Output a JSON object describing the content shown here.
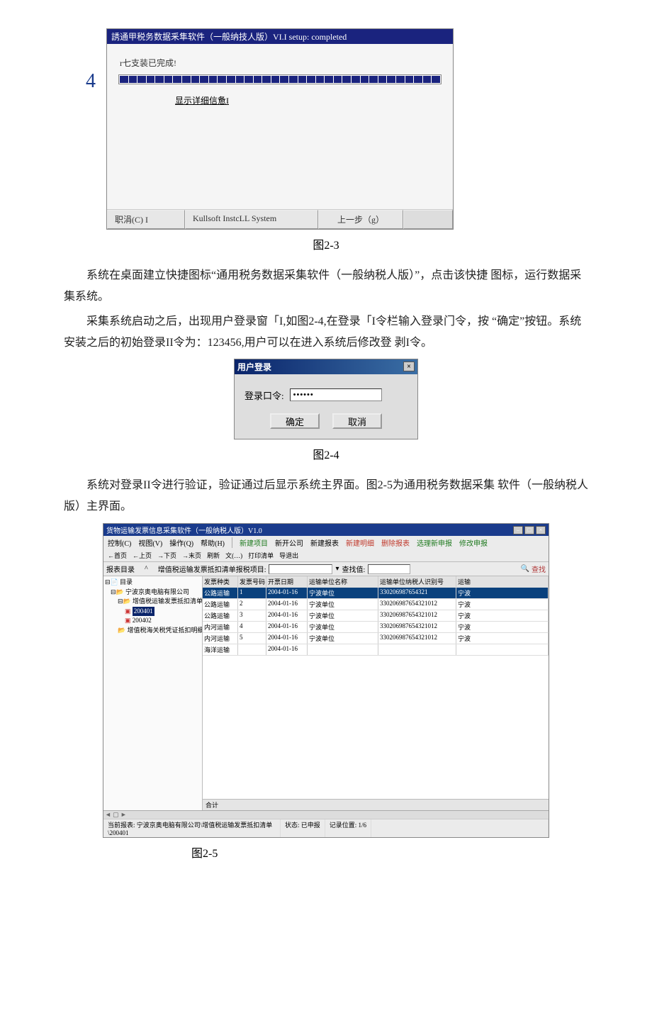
{
  "installer": {
    "title": "誘通甲税务数据釆隼软件（一般纳技人版）VI.I setup: completed",
    "done_text": "r七支装已完成!",
    "details_link": "显示详细信惫I",
    "footer": {
      "cancel": "职涓(C) I",
      "brand": "Kullsoft InstcLL System",
      "back": "上一步（g）"
    },
    "progress_label": "4"
  },
  "caption_2_3": "图2-3",
  "para1": "系统在桌面建立快捷图标“通用税务数据采集软件（一般纳税人版）”，点击该快捷 图标，运行数据采集系统。",
  "para2": "采集系统启动之后，出现用户登录窗「I,如图2-4,在登录「I令栏输入登录门令，按 “确定”按钮。系统安装之后的初始登录II令为：123456,用户可以在进入系统后修改登 剥I令。",
  "login": {
    "title": "用户登录",
    "close_label": "×",
    "label": "登录口令:",
    "password_mask": "******",
    "ok": "确定",
    "cancel": "取消"
  },
  "caption_2_4": "图2-4",
  "para3": "系统对登录II令进行验证，验证通过后显示系统主界面。图2-5为通用税务数据采集 软件（一般纳税人版）主界面。",
  "main_window": {
    "title": "货物运输发票信息采集软件（一般纳税人版）V1.0",
    "menus": [
      "控制(C)",
      "视图(V)",
      "操作(Q)",
      "帮助(H)"
    ],
    "menu_toolbar": [
      "新建项目",
      "新开公司",
      "新建报表",
      "新建明细",
      "删除报表",
      "选理新申报",
      "修改申报"
    ],
    "sub_toolbar": [
      "←首页",
      "←上页",
      "→下页",
      "→末页",
      "刷新",
      "文(…)",
      "打印清单",
      "导退出"
    ],
    "filter": {
      "tree_label": "报表目录",
      "handle": "^",
      "label1": "增值税运输发票抵扣清单报税项目:",
      "dropdown_marker": "▾",
      "label2": "查找值:",
      "search_btn": "查找"
    },
    "tree": {
      "root": "目录",
      "node1": "宁波京奥电脑有限公司",
      "node2": "增值税运输发票抵扣清单",
      "leaf1": "200401",
      "leaf2": "200402",
      "node3": "增值税海关税凭证抵扣明细"
    },
    "grid": {
      "headers": [
        "发票种类",
        "发票号码",
        "开票日期",
        "运输单位名称",
        "运输单位纳税人识别号",
        ""
      ],
      "rows": [
        {
          "c1": "公路运输",
          "c2": "1",
          "c3": "2004-01-16",
          "c4": "宁波单位",
          "c5": "330206987654321",
          "c6": "宁波"
        },
        {
          "c1": "公路运输",
          "c2": "2",
          "c3": "2004-01-16",
          "c4": "宁波单位",
          "c5": "330206987654321012",
          "c6": "宁波"
        },
        {
          "c1": "公路运输",
          "c2": "3",
          "c3": "2004-01-16",
          "c4": "宁波单位",
          "c5": "330206987654321012",
          "c6": "宁波"
        },
        {
          "c1": "内河运输",
          "c2": "4",
          "c3": "2004-01-16",
          "c4": "宁波单位",
          "c5": "330206987654321012",
          "c6": "宁波"
        },
        {
          "c1": "内河运输",
          "c2": "5",
          "c3": "2004-01-16",
          "c4": "宁波单位",
          "c5": "330206987654321012",
          "c6": "宁波"
        },
        {
          "c1": "海洋运输",
          "c2": "",
          "c3": "2004-01-16",
          "c4": "",
          "c5": "",
          "c6": ""
        }
      ],
      "grid_row6_extra": "运输",
      "total_label": "合计"
    },
    "status": {
      "left": "当前报表: 宁波京奥电脑有限公司\\增值税运输发票抵扣清单\\200401",
      "mid": "状态: 已申报",
      "right": "记录位置: 1/6"
    },
    "scroll_markers": "◄ ▢ ►"
  },
  "caption_2_5": "图2-5"
}
